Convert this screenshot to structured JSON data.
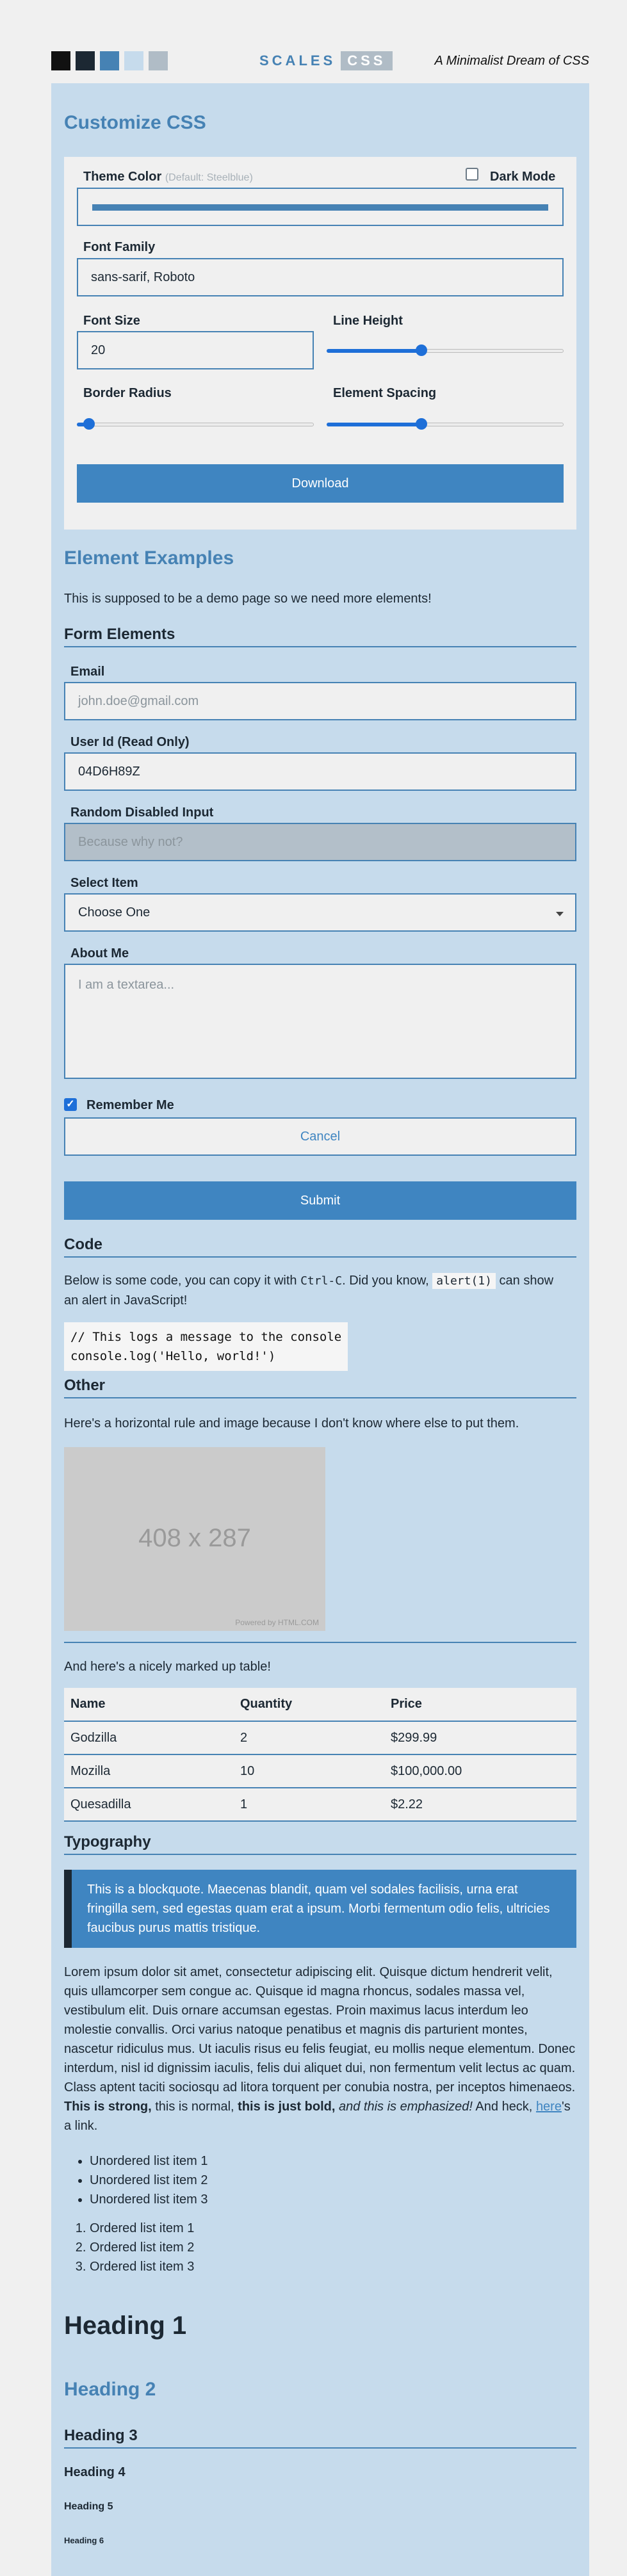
{
  "colors": {
    "swatches": [
      "#111111",
      "#1c2833",
      "#4682b4",
      "#c6dbec",
      "#b0bcc6"
    ],
    "accent": "#4682b4",
    "button": "#3f85c1",
    "background": "#c6dbec"
  },
  "header": {
    "logo_text": "SCALES",
    "logo_badge": "CSS",
    "tagline": "A Minimalist Dream of CSS"
  },
  "customize": {
    "title": "Customize CSS",
    "theme_color_label": "Theme Color",
    "theme_color_hint": "(Default: Steelblue)",
    "dark_mode_label": "Dark Mode",
    "dark_mode_checked": false,
    "font_family_label": "Font Family",
    "font_family_value": "sans-sarif, Roboto",
    "font_size_label": "Font Size",
    "font_size_value": "20",
    "line_height_label": "Line Height",
    "line_height_level": 0.4,
    "border_radius_label": "Border Radius",
    "border_radius_level": 0.05,
    "element_spacing_label": "Element Spacing",
    "element_spacing_level": 0.4,
    "download_label": "Download"
  },
  "examples": {
    "title": "Element Examples",
    "intro": "This is supposed to be a demo page so we need more elements!",
    "form_heading": "Form Elements",
    "email_label": "Email",
    "email_placeholder": "john.doe@gmail.com",
    "userid_label": "User Id (Read Only)",
    "userid_value": "04D6H89Z",
    "disabled_label": "Random Disabled Input",
    "disabled_placeholder": "Because why not?",
    "select_label": "Select Item",
    "select_value": "Choose One",
    "about_label": "About Me",
    "about_placeholder": "I am a textarea...",
    "remember_label": "Remember Me",
    "remember_checked": true,
    "cancel_label": "Cancel",
    "submit_label": "Submit"
  },
  "code": {
    "heading": "Code",
    "text_1": "Below is some code, you can copy it with ",
    "kbd": "Ctrl-C",
    "text_2": ". Did you know, ",
    "inline_code": "alert(1)",
    "text_3": " can show",
    "text_4": "an alert in JavaScript!",
    "block_line_1": "// This logs a message to the console",
    "block_line_2": "console.log('Hello, world!')"
  },
  "other": {
    "heading": "Other",
    "text": "Here's a horizontal rule and image because I don't know where else to put them.",
    "image_label": "408 x 287",
    "image_credit": "Powered by HTML.COM",
    "table_intro": "And here's a nicely marked up table!",
    "table_headers": [
      "Name",
      "Quantity",
      "Price"
    ],
    "table_rows": [
      [
        "Godzilla",
        "2",
        "$299.99"
      ],
      [
        "Mozilla",
        "10",
        "$100,000.00"
      ],
      [
        "Quesadilla",
        "1",
        "$2.22"
      ]
    ]
  },
  "typography": {
    "heading": "Typography",
    "blockquote": "This is a blockquote. Maecenas blandit, quam vel sodales facilisis, urna erat fringilla sem, sed egestas quam erat a ipsum. Morbi fermentum odio felis, ultricies faucibus purus mattis tristique.",
    "lorem": "Lorem ipsum dolor sit amet, consectetur adipiscing elit. Quisque dictum hendrerit velit, quis ullamcorper sem congue ac. Quisque id magna rhoncus, sodales massa vel, vestibulum elit. Duis ornare accumsan egestas. Proin maximus lacus interdum leo molestie convallis. Orci varius natoque penatibus et magnis dis parturient montes, nascetur ridiculus mus. Ut iaculis risus eu felis feugiat, eu mollis neque elementum. Donec interdum, nisl id dignissim iaculis, felis dui aliquet dui, non fermentum velit lectus ac quam. Class aptent taciti sociosqu ad litora torquent per conubia nostra, per inceptos himenaeos. ",
    "strong": "This is strong,",
    "normal": " this is normal, ",
    "bold": "this is just bold,",
    "em": " and this is emphasized!",
    "and_heck": " And heck, ",
    "link": "here",
    "link_tail": "'s a link.",
    "unordered": [
      "Unordered list item 1",
      "Unordered list item 2",
      "Unordered list item 3"
    ],
    "ordered": [
      "Ordered list item 1",
      "Ordered list item 2",
      "Ordered list item 3"
    ],
    "h1": "Heading 1",
    "h2": "Heading 2",
    "h3": "Heading 3",
    "h4": "Heading 4",
    "h5": "Heading 5",
    "h6": "Heading 6"
  }
}
